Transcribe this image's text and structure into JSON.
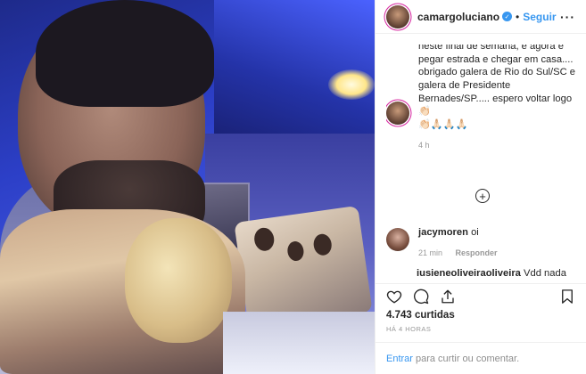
{
  "post": {
    "username": "camargoluciano",
    "follow_label": "Seguir",
    "separator": "•",
    "more_icon": "ellipsis-icon"
  },
  "caption": {
    "username": "camargoluciano",
    "text": "Como é bom, poder voltar pra casa com a sensação de dever cumprido, né?? Foram dois shows maravilhosos neste final de semana, e agora é pegar estrada e chegar em casa.... obrigado galera de Rio do Sul/SC e galera de Presidente Bernades/SP..... espero voltar logo👏🏻",
    "emojis": "👏🏻🙏🏻🙏🏻🙏🏻",
    "time": "4 h"
  },
  "comments": [
    {
      "username": "jacymoren",
      "text": "oi",
      "time": "21 min",
      "reply_label": "Responder"
    },
    {
      "username": "jusieneoliveiraoliveira",
      "text": "Vdd nada"
    }
  ],
  "actions": {
    "likes": "4.743 curtidas",
    "time": "HÁ 4 HORAS"
  },
  "add_comment": {
    "link": "Entrar",
    "text": "para curtir ou comentar."
  },
  "colors": {
    "link": "#3897f0",
    "text": "#262626",
    "muted": "#999999"
  }
}
